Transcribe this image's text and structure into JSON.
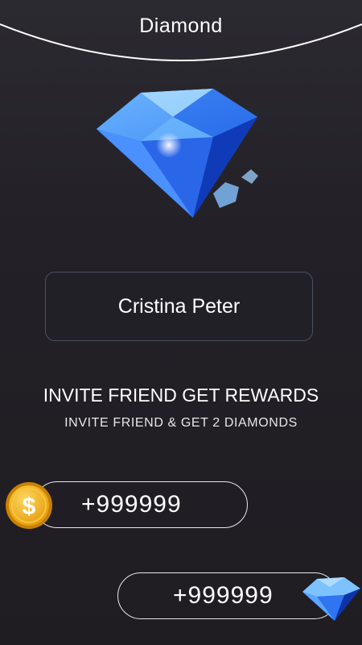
{
  "header": {
    "title": "Diamond"
  },
  "profile": {
    "name": "Cristina Peter"
  },
  "invite": {
    "title": "INVITE FRIEND GET REWARDS",
    "subtitle": "INVITE FRIEND & GET 2 DIAMONDS"
  },
  "rewards": {
    "coins": {
      "value": "+999999",
      "icon": "dollar-coin-icon"
    },
    "diamonds": {
      "value": "+999999",
      "icon": "diamond-icon"
    }
  },
  "colors": {
    "background": "#232127",
    "diamond_blue": "#2f6ff0",
    "coin_gold": "#f2b31a",
    "pill_border": "#e8e8ec"
  }
}
